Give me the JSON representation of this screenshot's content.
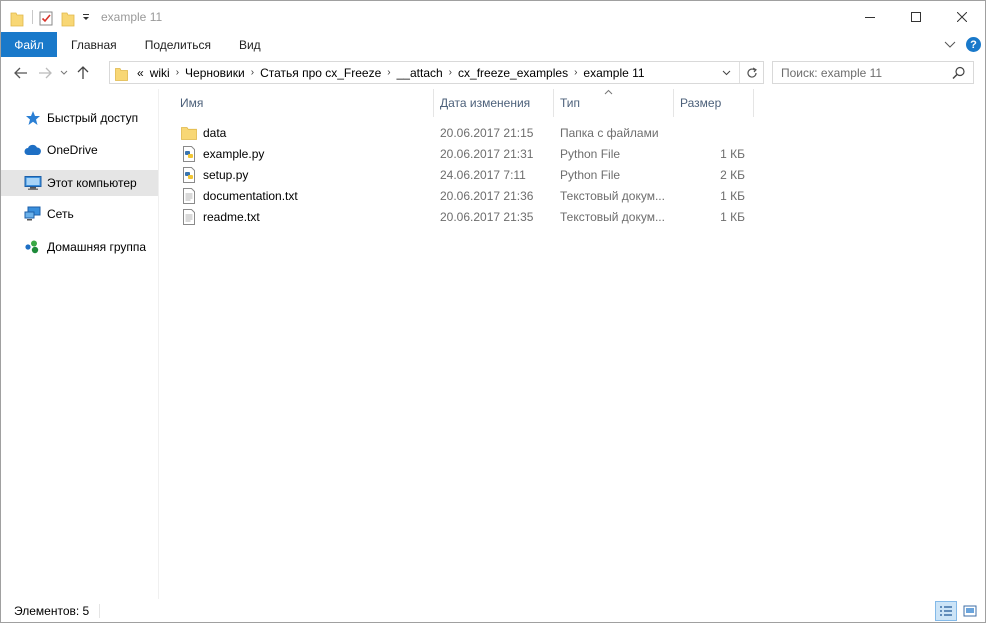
{
  "window": {
    "title": "example 11",
    "controls": [
      "minimize",
      "maximize",
      "close"
    ]
  },
  "ribbon": {
    "tabs": [
      {
        "label": "Файл",
        "active": true
      },
      {
        "label": "Главная"
      },
      {
        "label": "Поделиться"
      },
      {
        "label": "Вид"
      }
    ]
  },
  "address": {
    "overflow": "«",
    "crumbs": [
      "wiki",
      "Черновики",
      "Статья про cx_Freeze",
      "__attach",
      "cx_freeze_examples",
      "example 11"
    ]
  },
  "search": {
    "placeholder": "Поиск: example 11"
  },
  "sidebar": {
    "items": [
      {
        "label": "Быстрый доступ",
        "icon": "star-icon",
        "active": false
      },
      {
        "label": "OneDrive",
        "icon": "cloud-icon",
        "active": false
      },
      {
        "label": "Этот компьютер",
        "icon": "computer-icon",
        "active": true
      },
      {
        "label": "Сеть",
        "icon": "network-icon",
        "active": false
      },
      {
        "label": "Домашняя группа",
        "icon": "homegroup-icon",
        "active": false
      }
    ]
  },
  "columns": {
    "name": "Имя",
    "date": "Дата изменения",
    "type": "Тип",
    "size": "Размер"
  },
  "files": [
    {
      "name": "data",
      "date": "20.06.2017 21:15",
      "type": "Папка с файлами",
      "size": "",
      "icon": "folder-icon"
    },
    {
      "name": "example.py",
      "date": "20.06.2017 21:31",
      "type": "Python File",
      "size": "1 КБ",
      "icon": "python-file-icon"
    },
    {
      "name": "setup.py",
      "date": "24.06.2017 7:11",
      "type": "Python File",
      "size": "2 КБ",
      "icon": "python-file-icon"
    },
    {
      "name": "documentation.txt",
      "date": "20.06.2017 21:36",
      "type": "Текстовый докум...",
      "size": "1 КБ",
      "icon": "text-file-icon"
    },
    {
      "name": "readme.txt",
      "date": "20.06.2017 21:35",
      "type": "Текстовый докум...",
      "size": "1 КБ",
      "icon": "text-file-icon"
    }
  ],
  "status": {
    "count_label": "Элементов: 5"
  },
  "colors": {
    "accent": "#1979ca",
    "folder": "#f8d775",
    "header_text": "#4c607a",
    "selected_nav": "#e5e5e5"
  }
}
